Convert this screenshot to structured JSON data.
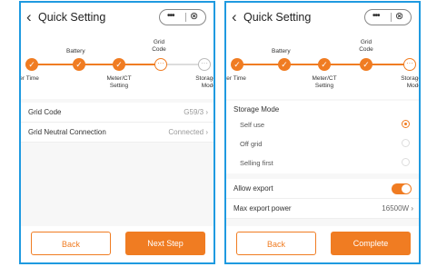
{
  "left": {
    "title": "Quick Setting",
    "steps": [
      {
        "label": "Inverter Time",
        "status": "done",
        "glyph": "✓"
      },
      {
        "label": "Battery",
        "status": "done",
        "glyph": "✓"
      },
      {
        "label": "Meter/CT Setting",
        "status": "done",
        "glyph": "✓"
      },
      {
        "label": "Grid Code",
        "status": "current",
        "glyph": "···"
      },
      {
        "label": "Storage Mode",
        "status": "pending",
        "glyph": "···"
      }
    ],
    "rows": [
      {
        "label": "Grid Code",
        "value": "G59/3"
      },
      {
        "label": "Grid Neutral Connection",
        "value": "Connected"
      }
    ],
    "back_label": "Back",
    "next_label": "Next Step"
  },
  "right": {
    "title": "Quick Setting",
    "steps": [
      {
        "label": "Inverter Time",
        "status": "done",
        "glyph": "✓"
      },
      {
        "label": "Battery",
        "status": "done",
        "glyph": "✓"
      },
      {
        "label": "Meter/CT Setting",
        "status": "done",
        "glyph": "✓"
      },
      {
        "label": "Grid Code",
        "status": "done",
        "glyph": "✓"
      },
      {
        "label": "Storage Mode",
        "status": "current",
        "glyph": "···"
      }
    ],
    "storage_mode_title": "Storage Mode",
    "storage_options": [
      {
        "label": "Self use",
        "selected": true
      },
      {
        "label": "Off grid",
        "selected": false
      },
      {
        "label": "Selling first",
        "selected": false
      }
    ],
    "allow_export_label": "Allow export",
    "allow_export_on": true,
    "max_export_label": "Max export power",
    "max_export_value": "16500W",
    "back_label": "Back",
    "complete_label": "Complete"
  },
  "capsule": {
    "dots": "•••",
    "close": "⊗"
  },
  "icons": {
    "back": "‹",
    "chevron": "›"
  },
  "colors": {
    "accent": "#f07c22",
    "frame": "#1f9ae0"
  }
}
